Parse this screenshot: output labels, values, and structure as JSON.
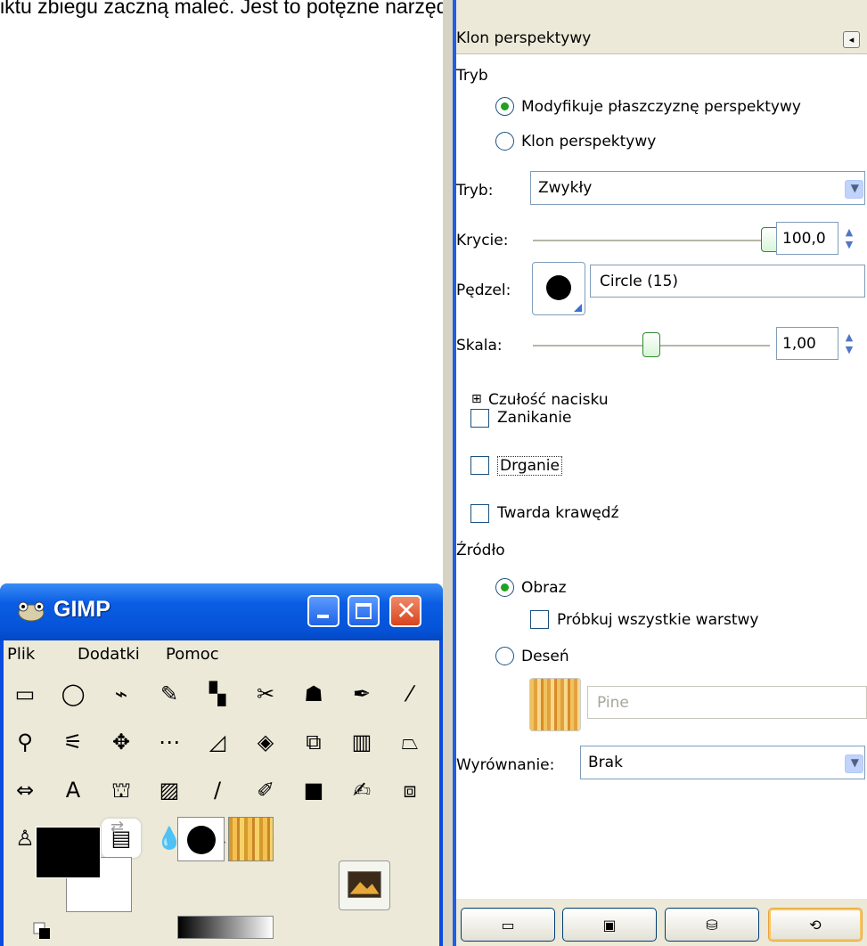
{
  "page_top_text": "iktu zbiegu zaczną maleć. Jest to potężne narzędzie w rękach wykwalifikowanego",
  "gimp_window": {
    "title": "GIMP",
    "menu": [
      {
        "label": "Plik"
      },
      {
        "label": "Dodatki"
      },
      {
        "label": "Pomoc"
      }
    ],
    "tools": [
      {
        "icon": "rect-select-icon",
        "glyph": "▭"
      },
      {
        "icon": "ellipse-select-icon",
        "glyph": "◯"
      },
      {
        "icon": "free-select-icon",
        "glyph": "⌁"
      },
      {
        "icon": "fuzzy-select-icon",
        "glyph": "✎"
      },
      {
        "icon": "select-by-color-icon",
        "glyph": "▚"
      },
      {
        "icon": "scissors-icon",
        "glyph": "✂"
      },
      {
        "icon": "foreground-select-icon",
        "glyph": "☗"
      },
      {
        "icon": "paths-icon",
        "glyph": "✒"
      },
      {
        "icon": "color-picker-icon",
        "glyph": "⁄"
      },
      {
        "icon": "zoom-icon",
        "glyph": "⚲"
      },
      {
        "icon": "measure-icon",
        "glyph": "⚟"
      },
      {
        "icon": "move-icon",
        "glyph": "✥"
      },
      {
        "icon": "align-icon",
        "glyph": "⋯"
      },
      {
        "icon": "crop-icon",
        "glyph": "◿"
      },
      {
        "icon": "rotate-icon",
        "glyph": "◈"
      },
      {
        "icon": "scale-icon",
        "glyph": "⧉"
      },
      {
        "icon": "shear-icon",
        "glyph": "▥"
      },
      {
        "icon": "perspective-icon",
        "glyph": "⏢"
      },
      {
        "icon": "flip-icon",
        "glyph": "⇔"
      },
      {
        "icon": "text-icon",
        "glyph": "A"
      },
      {
        "icon": "bucket-fill-icon",
        "glyph": "⛫"
      },
      {
        "icon": "blend-icon",
        "glyph": "▨"
      },
      {
        "icon": "pencil-icon",
        "glyph": "∕"
      },
      {
        "icon": "paintbrush-icon",
        "glyph": "✐"
      },
      {
        "icon": "eraser-icon",
        "glyph": "■"
      },
      {
        "icon": "airbrush-icon",
        "glyph": "✍"
      },
      {
        "icon": "ink-icon",
        "glyph": "⧈"
      },
      {
        "icon": "clone-icon",
        "glyph": "♙"
      },
      {
        "icon": "heal-icon",
        "glyph": "✖"
      },
      {
        "icon": "perspective-clone-icon",
        "glyph": "▤"
      },
      {
        "icon": "blur-sharpen-icon",
        "glyph": "💧"
      },
      {
        "icon": "smudge-icon",
        "glyph": "☡"
      },
      {
        "icon": "dodge-burn-icon",
        "glyph": "●"
      }
    ],
    "colors": {
      "foreground": "#000000",
      "background": "#ffffff"
    }
  },
  "tool_options": {
    "panel_title": "Klon perspektywy",
    "mode_section_label": "Tryb",
    "mode_options": [
      {
        "label": "Modyfikuje płaszczyznę perspektywy",
        "selected": true
      },
      {
        "label": "Klon perspektywy",
        "selected": false
      }
    ],
    "blend_mode": {
      "label": "Tryb:",
      "value": "Zwykły"
    },
    "opacity": {
      "label": "Krycie:",
      "value": "100,0",
      "fraction": 1.0
    },
    "brush": {
      "label": "Pędzel:",
      "name": "Circle (15)"
    },
    "scale": {
      "label": "Skala:",
      "value": "1,00",
      "fraction": 0.5
    },
    "pressure": {
      "label": "Czułość nacisku",
      "expander": "⊞"
    },
    "checkboxes": [
      {
        "label": "Zanikanie",
        "checked": false
      },
      {
        "label": "Drganie",
        "checked": false
      },
      {
        "label": "Twarda krawędź",
        "checked": false
      }
    ],
    "source": {
      "label": "Źródło",
      "image_option": {
        "label": "Obraz",
        "selected": true
      },
      "sample_merged": {
        "label": "Próbkuj wszystkie warstwy",
        "checked": false
      },
      "pattern_option": {
        "label": "Deseń",
        "selected": false
      },
      "pattern_name": "Pine"
    },
    "alignment": {
      "label": "Wyrównanie:",
      "value": "Brak"
    },
    "bottom_buttons": [
      {
        "icon": "save-icon",
        "glyph": "▭"
      },
      {
        "icon": "restore-icon",
        "glyph": "▣"
      },
      {
        "icon": "delete-icon",
        "glyph": "⛁"
      },
      {
        "icon": "reset-icon",
        "glyph": "⟲"
      }
    ]
  }
}
